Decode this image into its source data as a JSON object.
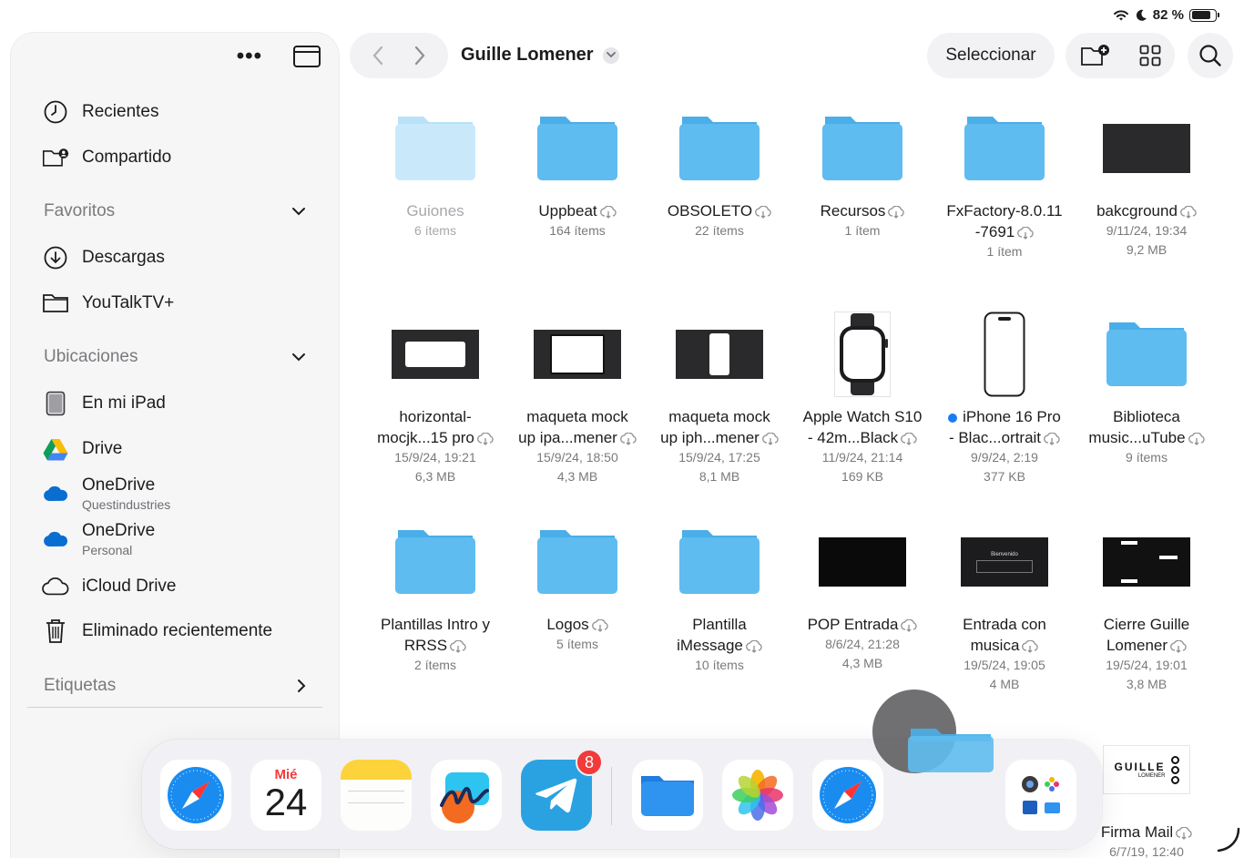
{
  "status": {
    "battery": "82 %",
    "battery_level": 0.82
  },
  "sidebar": {
    "recent": "Recientes",
    "shared": "Compartido",
    "favorites_header": "Favoritos",
    "downloads": "Descargas",
    "youtalk": "YouTalkTV+",
    "locations_header": "Ubicaciones",
    "ipad": "En mi iPad",
    "drive": "Drive",
    "onedrive1": {
      "label": "OneDrive",
      "sub": "Questindustries"
    },
    "onedrive2": {
      "label": "OneDrive",
      "sub": "Personal"
    },
    "icloud": "iCloud Drive",
    "trash": "Eliminado recientemente",
    "tags_header": "Etiquetas"
  },
  "toolbar": {
    "title": "Guille Lomener",
    "select": "Seleccionar"
  },
  "items": [
    {
      "name": "Guiones",
      "meta1": "6 ítems",
      "meta2": ""
    },
    {
      "name": "Uppbeat",
      "meta1": "164 ítems",
      "meta2": ""
    },
    {
      "name": "OBSOLETO",
      "meta1": "22 ítems",
      "meta2": ""
    },
    {
      "name": "Recursos",
      "meta1": "1 ítem",
      "meta2": ""
    },
    {
      "name1": "FxFactory-8.0.11",
      "name2": "-7691",
      "meta1": "1 ítem",
      "meta2": ""
    },
    {
      "name": "bakcground",
      "meta1": "9/11/24, 19:34",
      "meta2": "9,2 MB"
    },
    {
      "name1": "horizontal-",
      "name2": "mocjk...15 pro",
      "meta1": "15/9/24, 19:21",
      "meta2": "6,3 MB"
    },
    {
      "name1": "maqueta mock",
      "name2": "up ipa...mener",
      "meta1": "15/9/24, 18:50",
      "meta2": "4,3 MB"
    },
    {
      "name1": "maqueta mock",
      "name2": "up iph...mener",
      "meta1": "15/9/24, 17:25",
      "meta2": "8,1 MB"
    },
    {
      "name1": "Apple Watch S10",
      "name2": "- 42m...Black",
      "meta1": "11/9/24, 21:14",
      "meta2": "169 KB"
    },
    {
      "name1": "iPhone 16 Pro",
      "name2": "- Blac...ortrait",
      "meta1": "9/9/24, 2:19",
      "meta2": "377 KB"
    },
    {
      "name1": "Biblioteca",
      "name2": "music...uTube",
      "meta1": "9 ítems",
      "meta2": ""
    },
    {
      "name1": "Plantillas Intro y",
      "name2": "RRSS",
      "meta1": "2 ítems",
      "meta2": ""
    },
    {
      "name": "Logos",
      "meta1": "5 ítems",
      "meta2": ""
    },
    {
      "name1": "Plantilla",
      "name2": "iMessage",
      "meta1": "10 ítems",
      "meta2": ""
    },
    {
      "name": "POP Entrada",
      "meta1": "8/6/24, 21:28",
      "meta2": "4,3 MB"
    },
    {
      "name1": "Entrada con",
      "name2": "musica",
      "meta1": "19/5/24, 19:05",
      "meta2": "4 MB"
    },
    {
      "name1": "Cierre Guille",
      "name2": "Lomener",
      "meta1": "19/5/24, 19:01",
      "meta2": "3,8 MB"
    },
    {
      "name": "Firma Mail",
      "meta1": "6/7/19, 12:40",
      "meta2": ""
    }
  ],
  "thumb_text": {
    "bienvenido": "Bienvenido",
    "guille": "GUILLE",
    "lomener": "LOMENER"
  },
  "dock": {
    "calendar_day": "Mié",
    "calendar_date": "24",
    "telegram_badge": "8"
  }
}
